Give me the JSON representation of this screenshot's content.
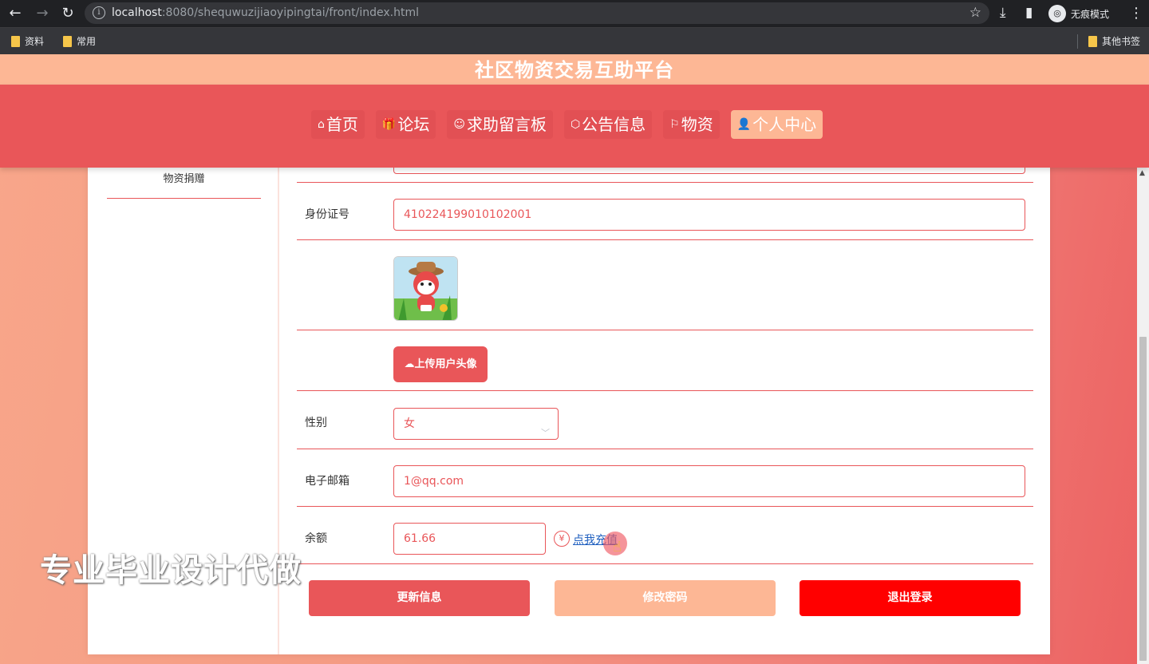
{
  "browser": {
    "url_host": "localhost",
    "url_rest": ":8080/shequwuzijiaoyipingtai/front/index.html",
    "incognito_label": "无痕模式",
    "bookmarks": [
      "资料",
      "常用"
    ],
    "other_bookmarks": "其他书签"
  },
  "site": {
    "title": "社区物资交易互助平台"
  },
  "nav": {
    "items": [
      {
        "icon": "⌂",
        "label": "首页"
      },
      {
        "icon": "🎁",
        "label": "论坛"
      },
      {
        "icon": "☺",
        "label": "求助留言板"
      },
      {
        "icon": "⬡",
        "label": "公告信息"
      },
      {
        "icon": "⚐",
        "label": "物资"
      },
      {
        "icon": "👤",
        "label": "个人中心"
      }
    ]
  },
  "sidebar": {
    "items": [
      "物资捐赠"
    ]
  },
  "form": {
    "id_label": "身份证号",
    "id_value": "410224199010102001",
    "upload_label": "上传用户头像",
    "gender_label": "性别",
    "gender_value": "女",
    "email_label": "电子邮箱",
    "email_value": "1@qq.com",
    "balance_label": "余额",
    "balance_value": "61.66",
    "currency_symbol": "¥",
    "recharge_label": "点我充值"
  },
  "buttons": {
    "update": "更新信息",
    "change_password": "修改密码",
    "logout": "退出登录"
  },
  "watermark": "专业毕业设计代做"
}
